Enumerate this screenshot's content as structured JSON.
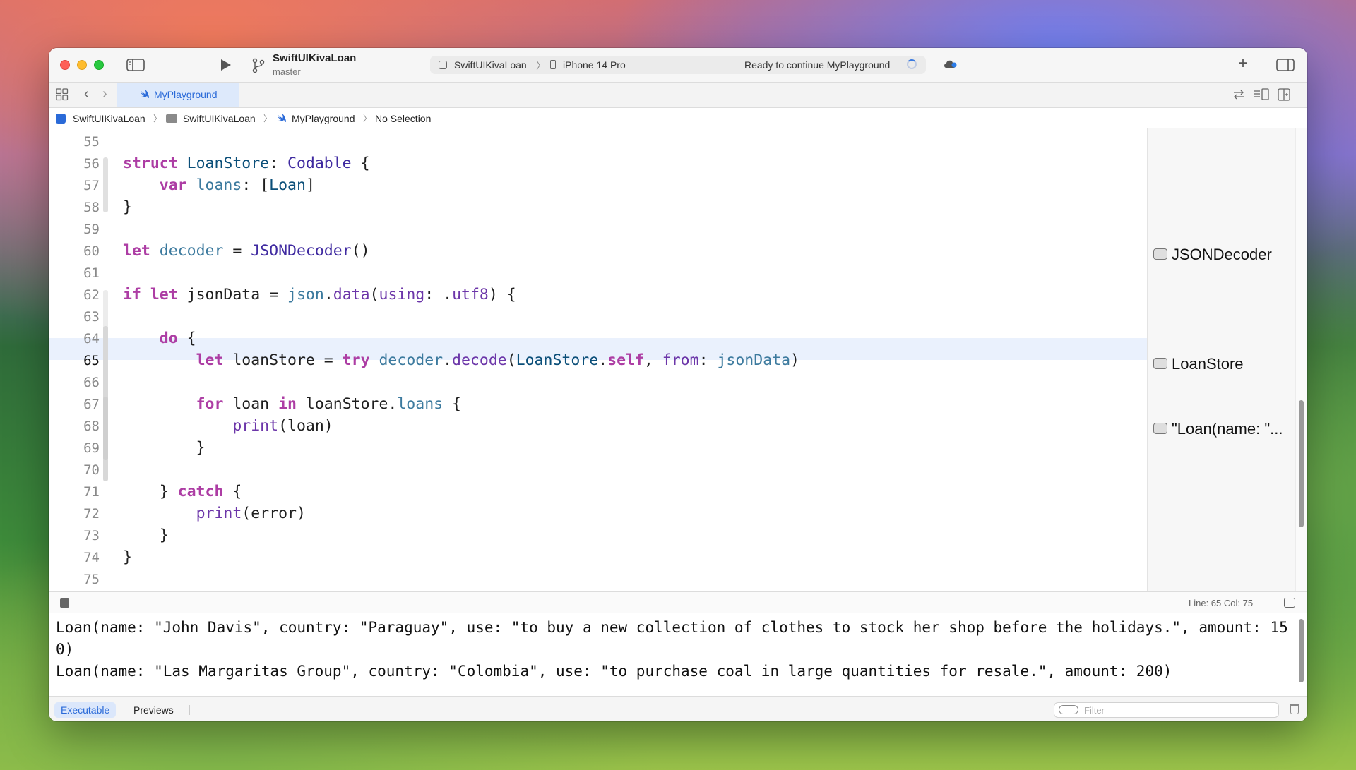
{
  "window": {
    "project_name": "SwiftUIKivaLoan",
    "branch": "master",
    "activity": {
      "scheme": "SwiftUIKivaLoan",
      "device": "iPhone 14 Pro",
      "status": "Ready to continue MyPlayground"
    }
  },
  "tabs": [
    {
      "label": "MyPlayground",
      "active": true
    }
  ],
  "breadcrumb": [
    "SwiftUIKivaLoan",
    "SwiftUIKivaLoan",
    "MyPlayground",
    "No Selection"
  ],
  "editor": {
    "current_line": 65,
    "line_numbers": [
      "55",
      "56",
      "57",
      "58",
      "59",
      "60",
      "61",
      "62",
      "63",
      "64",
      "65",
      "66",
      "67",
      "68",
      "69",
      "70",
      "71",
      "72",
      "73",
      "74",
      "75"
    ]
  },
  "results": [
    {
      "line": 60,
      "label": "JSONDecoder"
    },
    {
      "line": 65,
      "label": "LoanStore"
    },
    {
      "line": 68,
      "label": "\"Loan(name: \"..."
    }
  ],
  "status_bar": {
    "position": "Line: 65  Col: 75"
  },
  "console": {
    "output": "Loan(name: \"John Davis\", country: \"Paraguay\", use: \"to buy a new collection of clothes to stock her shop before the holidays.\", amount: 150)\nLoan(name: \"Las Margaritas Group\", country: \"Colombia\", use: \"to purchase coal in large quantities for resale.\", amount: 200)"
  },
  "bottom": {
    "executable_label": "Executable",
    "previews_label": "Previews",
    "filter_placeholder": "Filter"
  },
  "colors": {
    "keyword": "#ad3da4",
    "type": "#3f2aa0",
    "accent": "#2a6ad8",
    "current_line_bg": "#eaf1fd"
  }
}
